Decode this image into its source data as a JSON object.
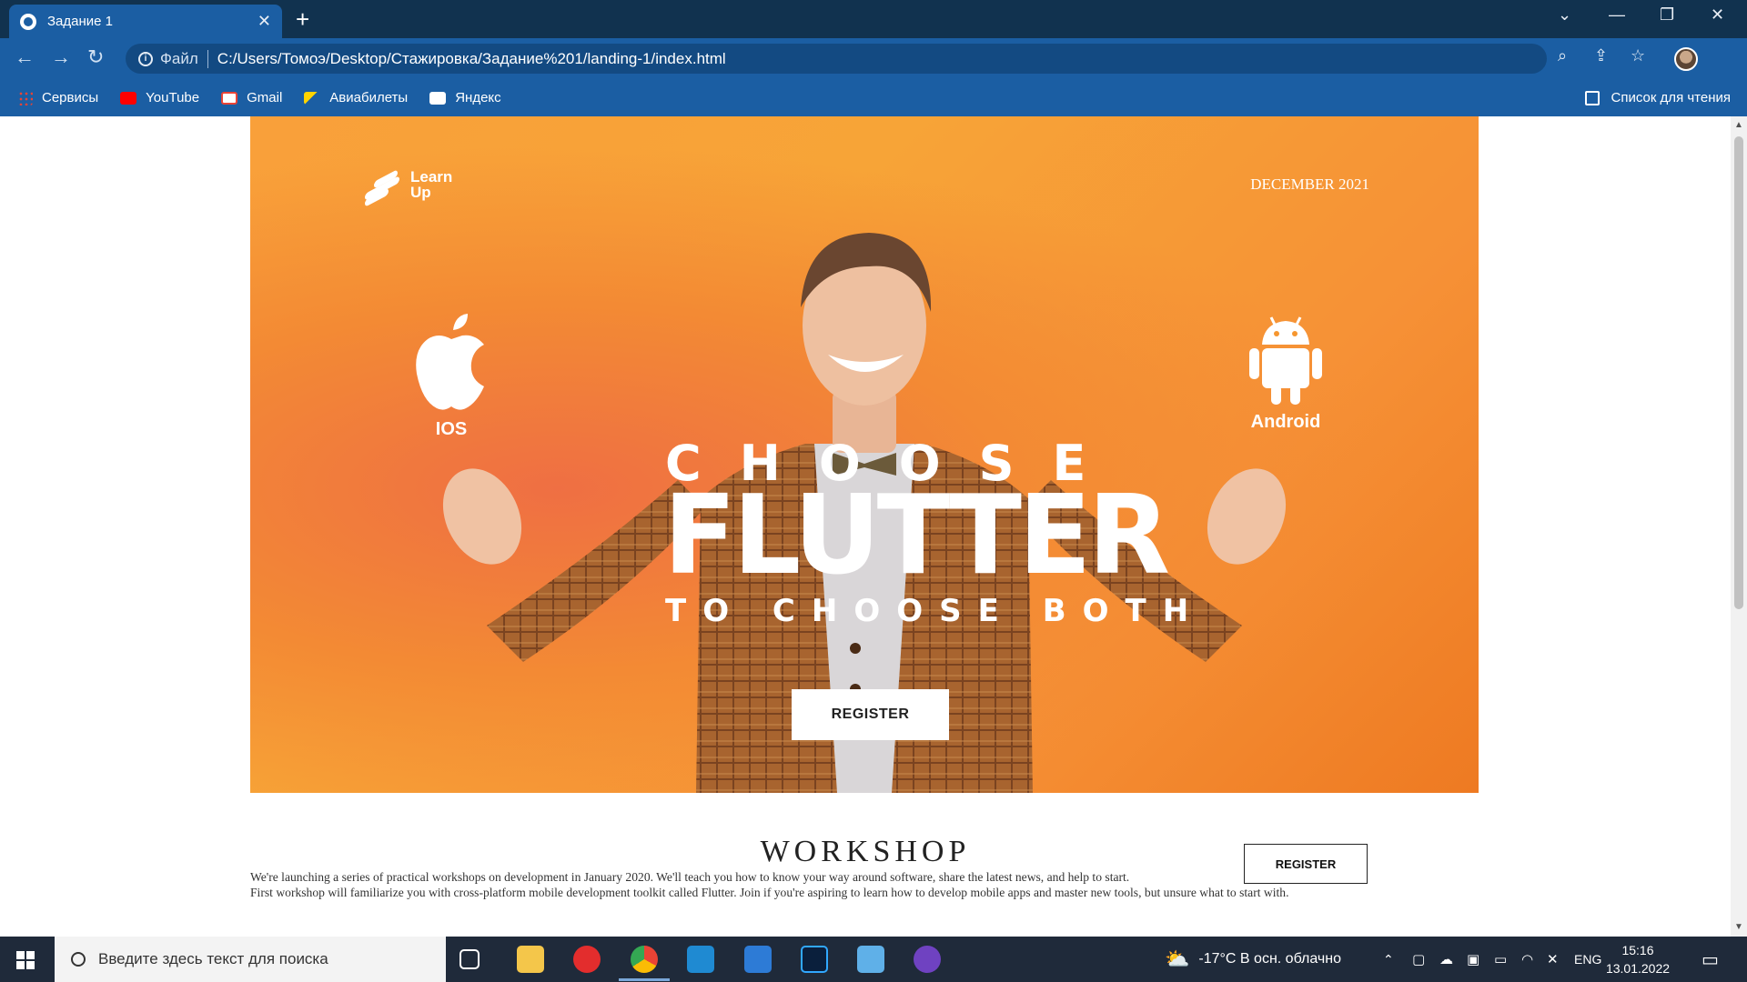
{
  "browser": {
    "tab_title": "Задание 1",
    "tab_close": "✕",
    "new_tab": "+",
    "address_scheme": "Файл",
    "address_url": "C:/Users/Томоэ/Desktop/Стажировка/Задание%201/landing-1/index.html",
    "bookmarks": [
      "Сервисы",
      "YouTube",
      "Gmail",
      "Авиабилеты",
      "Яндекс"
    ],
    "reading_list": "Список для чтения"
  },
  "page": {
    "logo_line1": "Learn",
    "logo_line2": "Up",
    "date": "DECEMBER 2021",
    "platform_ios": "IOS",
    "platform_android": "Android",
    "headline_top": "CHOOSE",
    "headline_main": "FLUTTER",
    "headline_bottom": "TO CHOOSE BOTH",
    "hero_register": "REGISTER",
    "workshop_title": "WORKSHOP",
    "workshop_line1": "We're launching a series of practical workshops on development in January 2020. We'll teach you how to know your way around software, share the latest news, and help to start.",
    "workshop_line2": "First workshop will familiarize you with cross-platform mobile development toolkit called Flutter. Join if you're aspiring to learn how to develop mobile apps and master new tools, but unsure what to start with.",
    "workshop_register": "REGISTER"
  },
  "taskbar": {
    "search_placeholder": "Введите здесь текст для поиска",
    "weather": "-17°C  В осн. облачно",
    "lang": "ENG",
    "time": "15:16",
    "date": "13.01.2022"
  }
}
